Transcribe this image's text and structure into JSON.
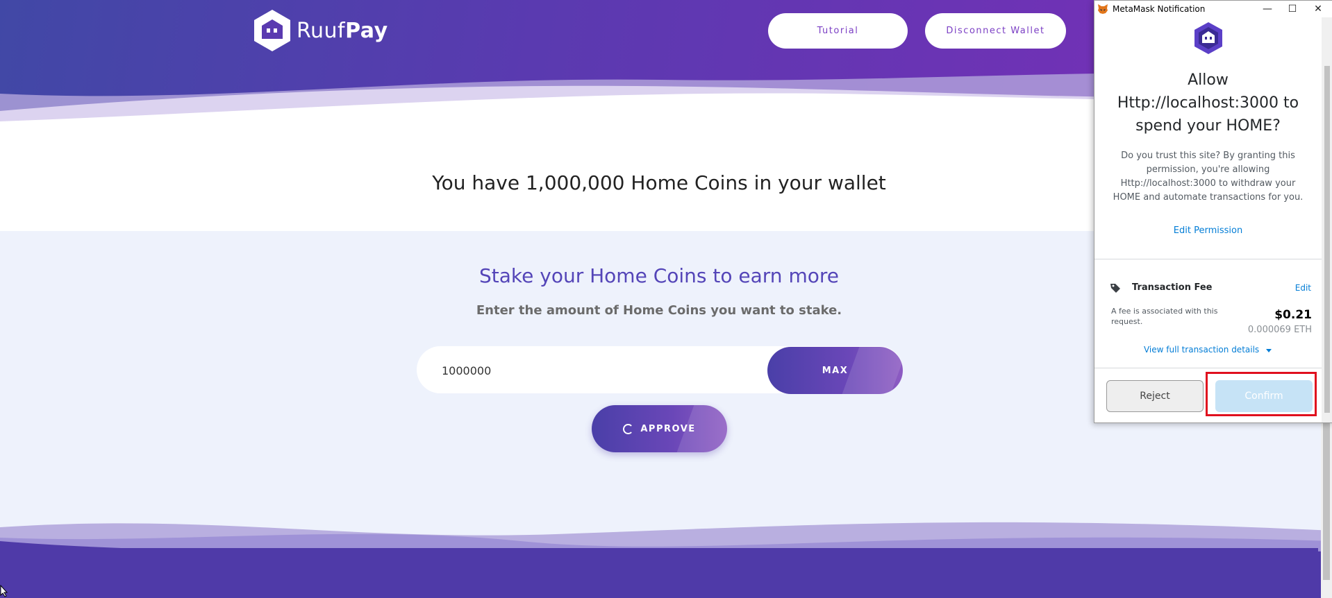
{
  "brand": {
    "name_regular": "Ruuf",
    "name_bold": "Pay"
  },
  "header": {
    "tutorial_label": "Tutorial",
    "disconnect_label": "Disconnect Wallet"
  },
  "balance": {
    "text": "You have 1,000,000 Home Coins in your wallet"
  },
  "stake": {
    "title": "Stake your Home Coins to earn more",
    "subtitle": "Enter the amount of Home Coins you want to stake.",
    "amount_value": "1000000",
    "max_label": "MAX",
    "approve_label": "APPROVE"
  },
  "metamask": {
    "window_title": "MetaMask Notification",
    "controls": {
      "minimize": "—",
      "maximize": "☐",
      "close": "✕"
    },
    "heading_line1": "Allow",
    "heading_line2": "Http://localhost:3000 to",
    "heading_line3": "spend your HOME?",
    "description": "Do you trust this site? By granting this permission, you're allowing Http://localhost:3000 to withdraw your HOME and automate transactions for you.",
    "edit_permission": "Edit Permission",
    "fee_label": "Transaction Fee",
    "fee_edit": "Edit",
    "fee_note": "A fee is associated with this request.",
    "fee_usd": "$0.21",
    "fee_eth": "0.000069 ETH",
    "view_details": "View full transaction details",
    "reject_label": "Reject",
    "confirm_label": "Confirm"
  },
  "colors": {
    "brand_purple": "#5445b8",
    "link_blue": "#037dd6",
    "highlight_red": "#e0101e"
  },
  "icons": [
    "ruufpay-logo",
    "metamask-fox-icon",
    "token-logo-icon",
    "tag-icon",
    "chevron-down-icon",
    "spinner-icon",
    "mouse-cursor"
  ]
}
